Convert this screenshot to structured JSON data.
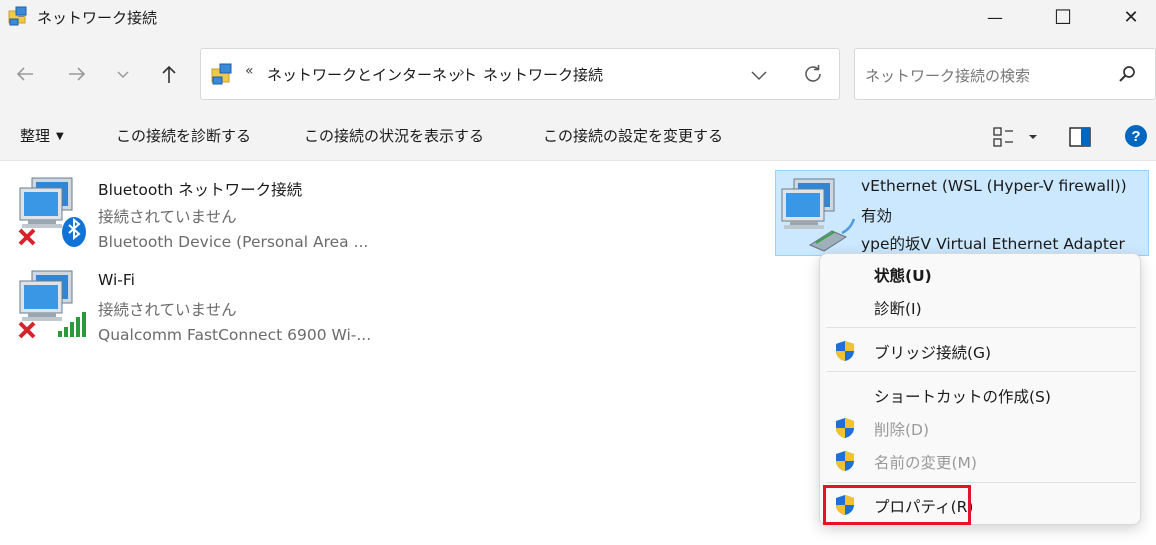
{
  "window": {
    "title": "ネットワーク接続",
    "minimize_glyph": "—",
    "maximize_glyph": "☐",
    "close_glyph": "✕"
  },
  "address": {
    "overflow": "«",
    "segment1": "ネットワークとインターネット",
    "chevron": "›",
    "segment2": "ネットワーク接続"
  },
  "search": {
    "placeholder": "ネットワーク接続の検索"
  },
  "toolbar": {
    "organize": "整理",
    "organize_caret": "▼",
    "diagnose": "この接続を診断する",
    "view_status": "この接続の状況を表示する",
    "change_settings": "この接続の設定を変更する"
  },
  "connections": [
    {
      "name": "Bluetooth ネットワーク接続",
      "status": "接続されていません",
      "device": "Bluetooth Device (Personal Area ..."
    },
    {
      "name": "Wi-Fi",
      "status": "接続されていません",
      "device": "Qualcomm FastConnect 6900 Wi-..."
    },
    {
      "name": "vEthernet (WSL (Hyper-V firewall))",
      "status": "有効",
      "device": "ype的坂V Virtual Ethernet Adapter"
    }
  ],
  "context_menu": [
    {
      "label": "状態(U)"
    },
    {
      "label": "診断(I)"
    },
    {
      "label": "ブリッジ接続(G)"
    },
    {
      "label": "ショートカットの作成(S)"
    },
    {
      "label": "削除(D)"
    },
    {
      "label": "名前の変更(M)"
    },
    {
      "label": "プロパティ(R)"
    }
  ],
  "icons": {
    "titlebar": "network-folder-icon",
    "back": "back-arrow-icon",
    "forward": "forward-arrow-icon",
    "recent": "chevron-down-icon",
    "up": "up-arrow-icon",
    "refresh": "refresh-icon",
    "search": "search-icon",
    "help": "help-icon",
    "uac": "uac-shield-icon"
  },
  "colors": {
    "selection_bg": "#cce8ff",
    "selection_border": "#99d1ff",
    "highlight_box": "#e0142a",
    "help_blue": "#0067c0"
  }
}
